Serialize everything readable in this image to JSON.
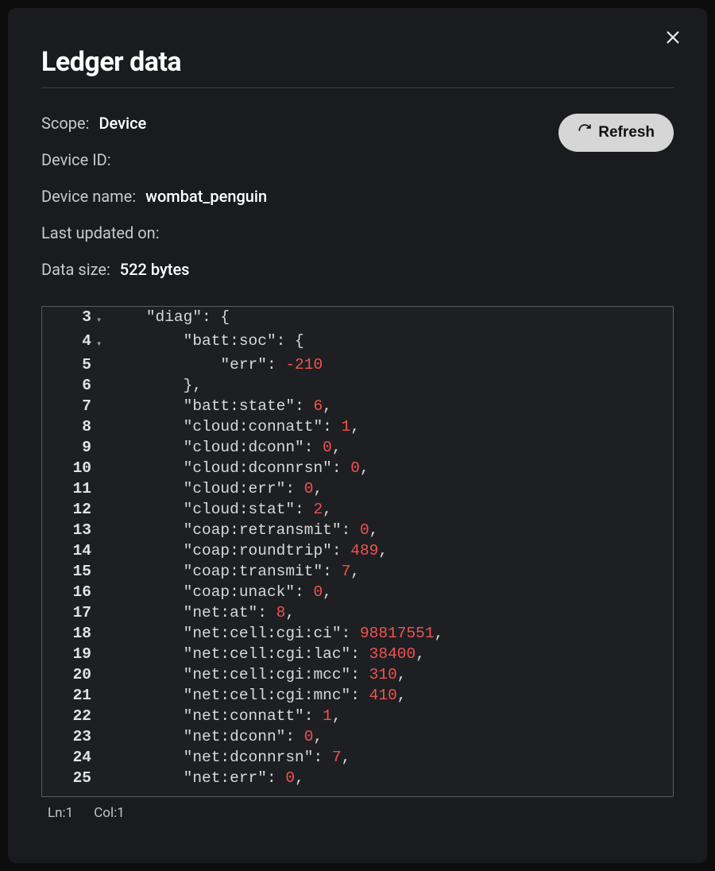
{
  "title": "Ledger data",
  "close_icon_name": "close-icon",
  "meta": {
    "scope_label": "Scope:",
    "scope_value": "Device",
    "device_id_label": "Device ID:",
    "device_id_value": "",
    "device_name_label": "Device name:",
    "device_name_value": "wombat_penguin",
    "last_updated_label": "Last updated on:",
    "last_updated_value": "",
    "data_size_label": "Data size:",
    "data_size_value": "522 bytes"
  },
  "refresh_label": "Refresh",
  "code_lines": [
    {
      "n": "3",
      "fold": true,
      "html": "    <span class=\"str\">\"diag\"</span><span class=\"pun\">: {</span>"
    },
    {
      "n": "4",
      "fold": true,
      "html": "        <span class=\"str\">\"batt:soc\"</span><span class=\"pun\">: {</span>"
    },
    {
      "n": "5",
      "fold": false,
      "html": "            <span class=\"str\">\"err\"</span><span class=\"pun\">: </span><span class=\"num\">-210</span>"
    },
    {
      "n": "6",
      "fold": false,
      "html": "        <span class=\"pun\">},</span>"
    },
    {
      "n": "7",
      "fold": false,
      "html": "        <span class=\"str\">\"batt:state\"</span><span class=\"pun\">: </span><span class=\"num\">6</span><span class=\"pun\">,</span>"
    },
    {
      "n": "8",
      "fold": false,
      "html": "        <span class=\"str\">\"cloud:connatt\"</span><span class=\"pun\">: </span><span class=\"num\">1</span><span class=\"pun\">,</span>"
    },
    {
      "n": "9",
      "fold": false,
      "html": "        <span class=\"str\">\"cloud:dconn\"</span><span class=\"pun\">: </span><span class=\"num\">0</span><span class=\"pun\">,</span>"
    },
    {
      "n": "10",
      "fold": false,
      "html": "        <span class=\"str\">\"cloud:dconnrsn\"</span><span class=\"pun\">: </span><span class=\"num\">0</span><span class=\"pun\">,</span>"
    },
    {
      "n": "11",
      "fold": false,
      "html": "        <span class=\"str\">\"cloud:err\"</span><span class=\"pun\">: </span><span class=\"num\">0</span><span class=\"pun\">,</span>"
    },
    {
      "n": "12",
      "fold": false,
      "html": "        <span class=\"str\">\"cloud:stat\"</span><span class=\"pun\">: </span><span class=\"num\">2</span><span class=\"pun\">,</span>"
    },
    {
      "n": "13",
      "fold": false,
      "html": "        <span class=\"str\">\"coap:retransmit\"</span><span class=\"pun\">: </span><span class=\"num\">0</span><span class=\"pun\">,</span>"
    },
    {
      "n": "14",
      "fold": false,
      "html": "        <span class=\"str\">\"coap:roundtrip\"</span><span class=\"pun\">: </span><span class=\"num\">489</span><span class=\"pun\">,</span>"
    },
    {
      "n": "15",
      "fold": false,
      "html": "        <span class=\"str\">\"coap:transmit\"</span><span class=\"pun\">: </span><span class=\"num\">7</span><span class=\"pun\">,</span>"
    },
    {
      "n": "16",
      "fold": false,
      "html": "        <span class=\"str\">\"coap:unack\"</span><span class=\"pun\">: </span><span class=\"num\">0</span><span class=\"pun\">,</span>"
    },
    {
      "n": "17",
      "fold": false,
      "html": "        <span class=\"str\">\"net:at\"</span><span class=\"pun\">: </span><span class=\"num\">8</span><span class=\"pun\">,</span>"
    },
    {
      "n": "18",
      "fold": false,
      "html": "        <span class=\"str\">\"net:cell:cgi:ci\"</span><span class=\"pun\">: </span><span class=\"num\">98817551</span><span class=\"pun\">,</span>"
    },
    {
      "n": "19",
      "fold": false,
      "html": "        <span class=\"str\">\"net:cell:cgi:lac\"</span><span class=\"pun\">: </span><span class=\"num\">38400</span><span class=\"pun\">,</span>"
    },
    {
      "n": "20",
      "fold": false,
      "html": "        <span class=\"str\">\"net:cell:cgi:mcc\"</span><span class=\"pun\">: </span><span class=\"num\">310</span><span class=\"pun\">,</span>"
    },
    {
      "n": "21",
      "fold": false,
      "html": "        <span class=\"str\">\"net:cell:cgi:mnc\"</span><span class=\"pun\">: </span><span class=\"num\">410</span><span class=\"pun\">,</span>"
    },
    {
      "n": "22",
      "fold": false,
      "html": "        <span class=\"str\">\"net:connatt\"</span><span class=\"pun\">: </span><span class=\"num\">1</span><span class=\"pun\">,</span>"
    },
    {
      "n": "23",
      "fold": false,
      "html": "        <span class=\"str\">\"net:dconn\"</span><span class=\"pun\">: </span><span class=\"num\">0</span><span class=\"pun\">,</span>"
    },
    {
      "n": "24",
      "fold": false,
      "html": "        <span class=\"str\">\"net:dconnrsn\"</span><span class=\"pun\">: </span><span class=\"num\">7</span><span class=\"pun\">,</span>"
    },
    {
      "n": "25",
      "fold": false,
      "html": "        <span class=\"str\">\"net:err\"</span><span class=\"pun\">: </span><span class=\"num\">0</span><span class=\"pun\">,</span>"
    }
  ],
  "status": {
    "line_label": "Ln:",
    "line_value": "1",
    "col_label": "Col:",
    "col_value": "1"
  }
}
